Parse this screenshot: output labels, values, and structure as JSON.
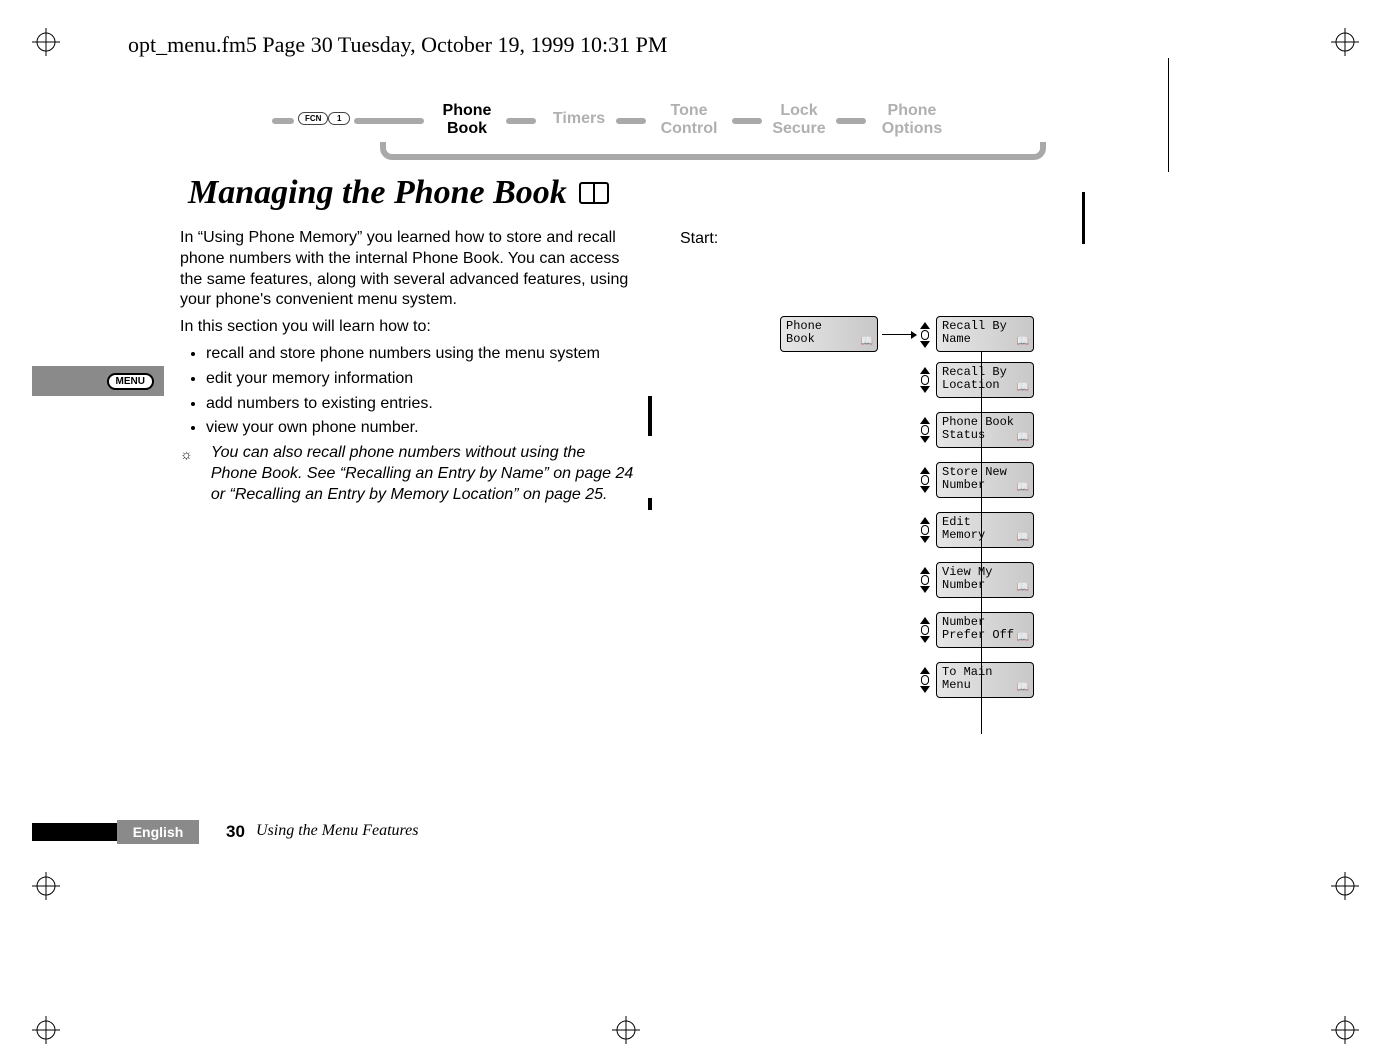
{
  "running_head": "opt_menu.fm5  Page 30  Tuesday, October 19, 1999  10:31 PM",
  "breadcrumb": {
    "fcn": "FCN",
    "one": "1",
    "items": [
      {
        "label": "Phone\nBook",
        "active": true
      },
      {
        "label": "Timers",
        "active": false
      },
      {
        "label": "Tone\nControl",
        "active": false
      },
      {
        "label": "Lock\nSecure",
        "active": false
      },
      {
        "label": "Phone\nOptions",
        "active": false
      }
    ]
  },
  "heading": "Managing the Phone Book",
  "body": {
    "p1": "In “Using Phone Memory”  you learned how to store and recall phone numbers with the internal Phone Book. You can access the same features, along with several advanced features, using your phone's convenient menu system.",
    "p2": "In this section you will learn how to:",
    "bullets": [
      "recall and store phone numbers using the menu system",
      "edit your memory information",
      "add numbers to existing entries.",
      "view your own phone number."
    ],
    "note": "You can also recall phone numbers without using the Phone Book. See “Recalling an Entry by Name” on page 24 or “Recalling an Entry by Memory Location” on page 25."
  },
  "start_label": "Start:",
  "menu_badge": "MENU",
  "tree": {
    "root": "Phone\nBook",
    "items": [
      "Recall By\nName",
      "Recall By\nLocation",
      "Phone Book\nStatus",
      "Store New\nNumber",
      "Edit\nMemory",
      "View My\nNumber",
      "Number\nPrefer Off",
      "To Main\nMenu"
    ]
  },
  "footer": {
    "language": "English",
    "page": "30",
    "section": "Using the Menu Features"
  }
}
